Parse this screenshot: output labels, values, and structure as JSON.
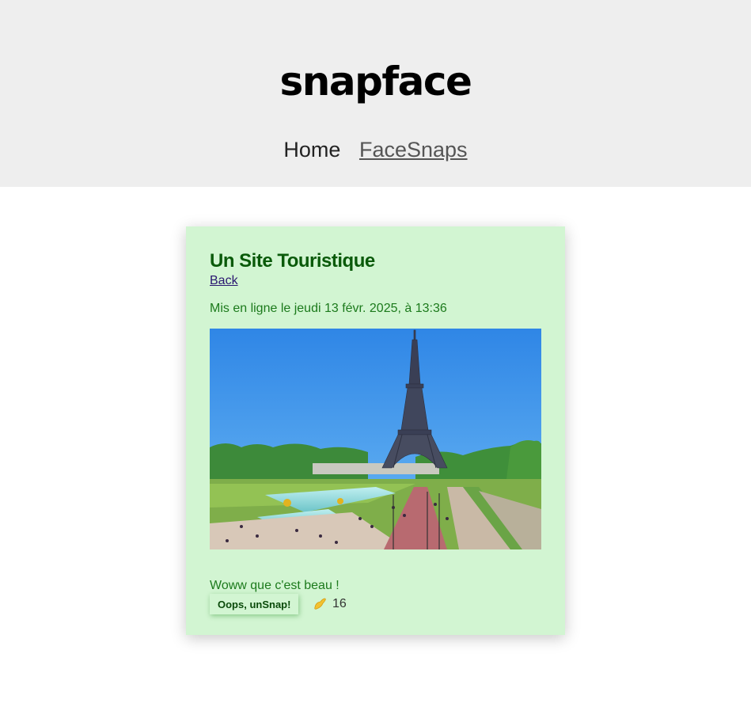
{
  "header": {
    "brand": "snapface",
    "nav": [
      {
        "label": "Home",
        "active": false
      },
      {
        "label": "FaceSnaps",
        "active": true
      }
    ]
  },
  "facesnap": {
    "title": "Un Site Touristique",
    "back_label": "Back",
    "date_text": "Mis en ligne le jeudi 13 févr. 2025, à 13:36",
    "image_alt": "Eiffel Tower seen from the Trocadéro gardens",
    "description": "Woww que c'est beau !",
    "unsnap_label": "Oops, unSnap!",
    "snaps_icon": "snap-fingers-icon",
    "snaps_count": "16"
  },
  "colors": {
    "header_bg": "#eeeeee",
    "card_bg": "#d2f5d2",
    "title": "#0a5a0a",
    "text_green": "#1c7a1c",
    "link": "#2a1670"
  }
}
